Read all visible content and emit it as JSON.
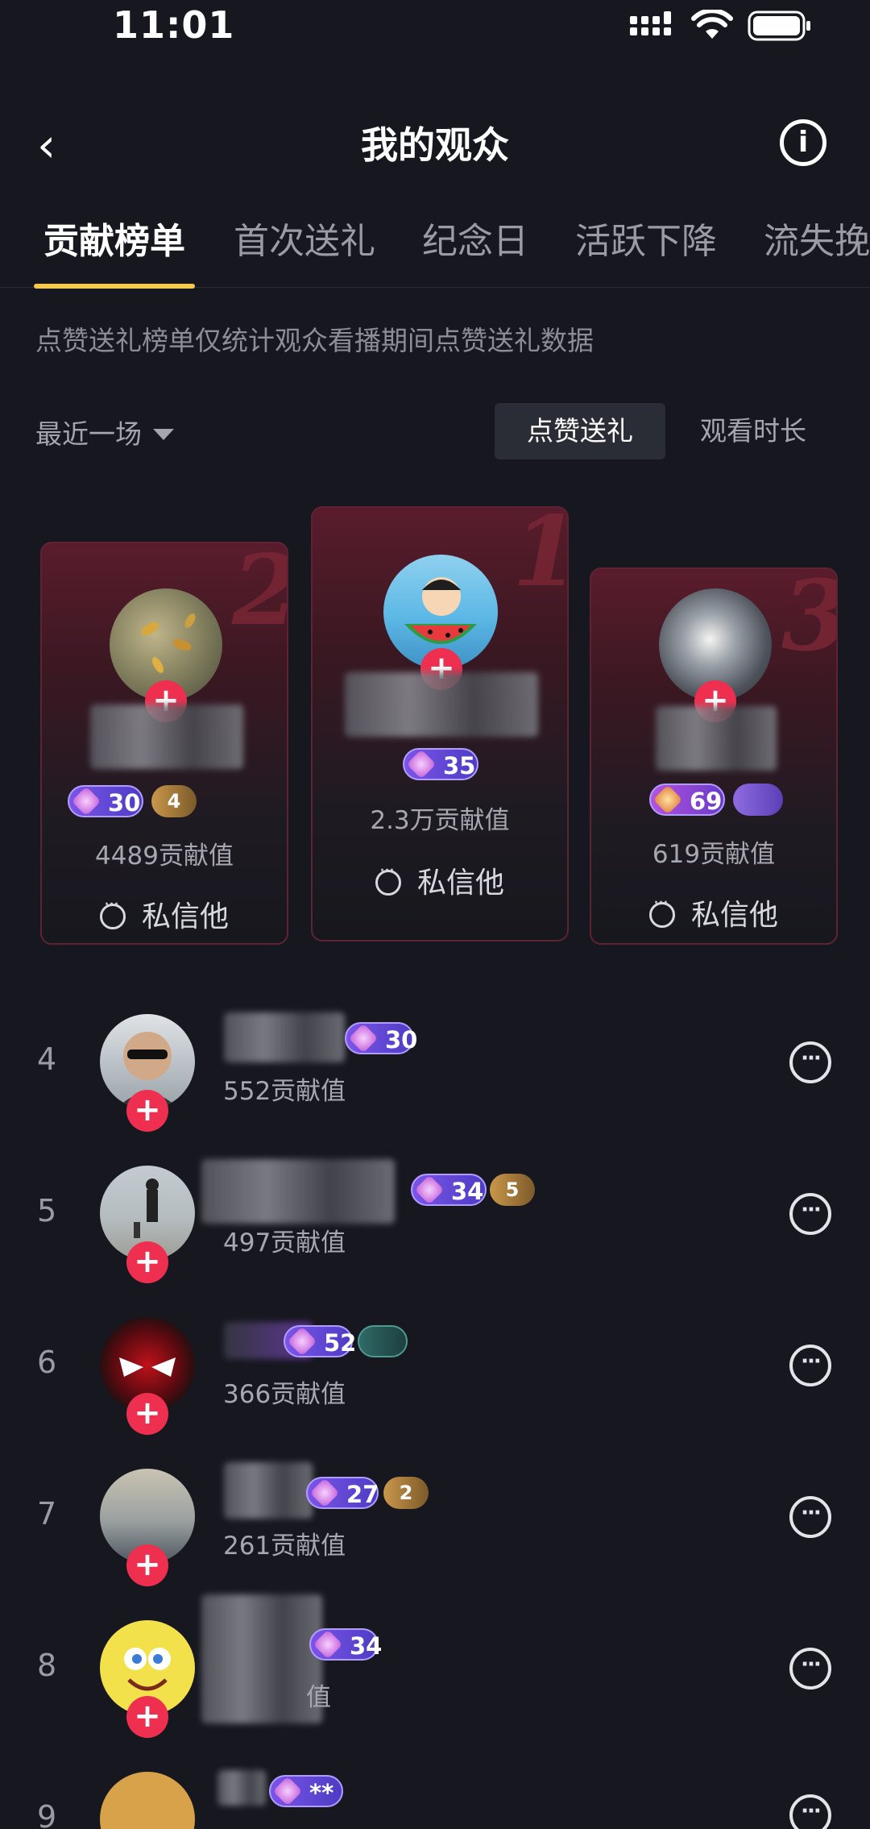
{
  "status": {
    "time": "11:01"
  },
  "nav": {
    "title": "我的观众"
  },
  "tabs": [
    "贡献榜单",
    "首次送礼",
    "纪念日",
    "活跃下降",
    "流失挽"
  ],
  "note": "点赞送礼榜单仅统计观众看播期间点赞送礼数据",
  "filter": {
    "label": "最近一场"
  },
  "segment": {
    "active": "点赞送礼",
    "inactive": "观看时长"
  },
  "podium": [
    {
      "rank": "2",
      "level": "30",
      "fan_level": "4",
      "value": "4489贡献值",
      "dm": "私信他"
    },
    {
      "rank": "1",
      "level": "35",
      "value": "2.3万贡献值",
      "dm": "私信他"
    },
    {
      "rank": "3",
      "level": "69",
      "value": "619贡献值",
      "dm": "私信他"
    }
  ],
  "list": [
    {
      "rank": "4",
      "level": "30",
      "value": "552贡献值"
    },
    {
      "rank": "5",
      "level": "34",
      "fan_level": "5",
      "value": "497贡献值"
    },
    {
      "rank": "6",
      "level": "52",
      "value": "366贡献值"
    },
    {
      "rank": "7",
      "level": "27",
      "fan_level": "2",
      "value": "261贡献值"
    },
    {
      "rank": "8",
      "level": "34",
      "value": "值"
    },
    {
      "rank": "9",
      "level": "**"
    }
  ]
}
